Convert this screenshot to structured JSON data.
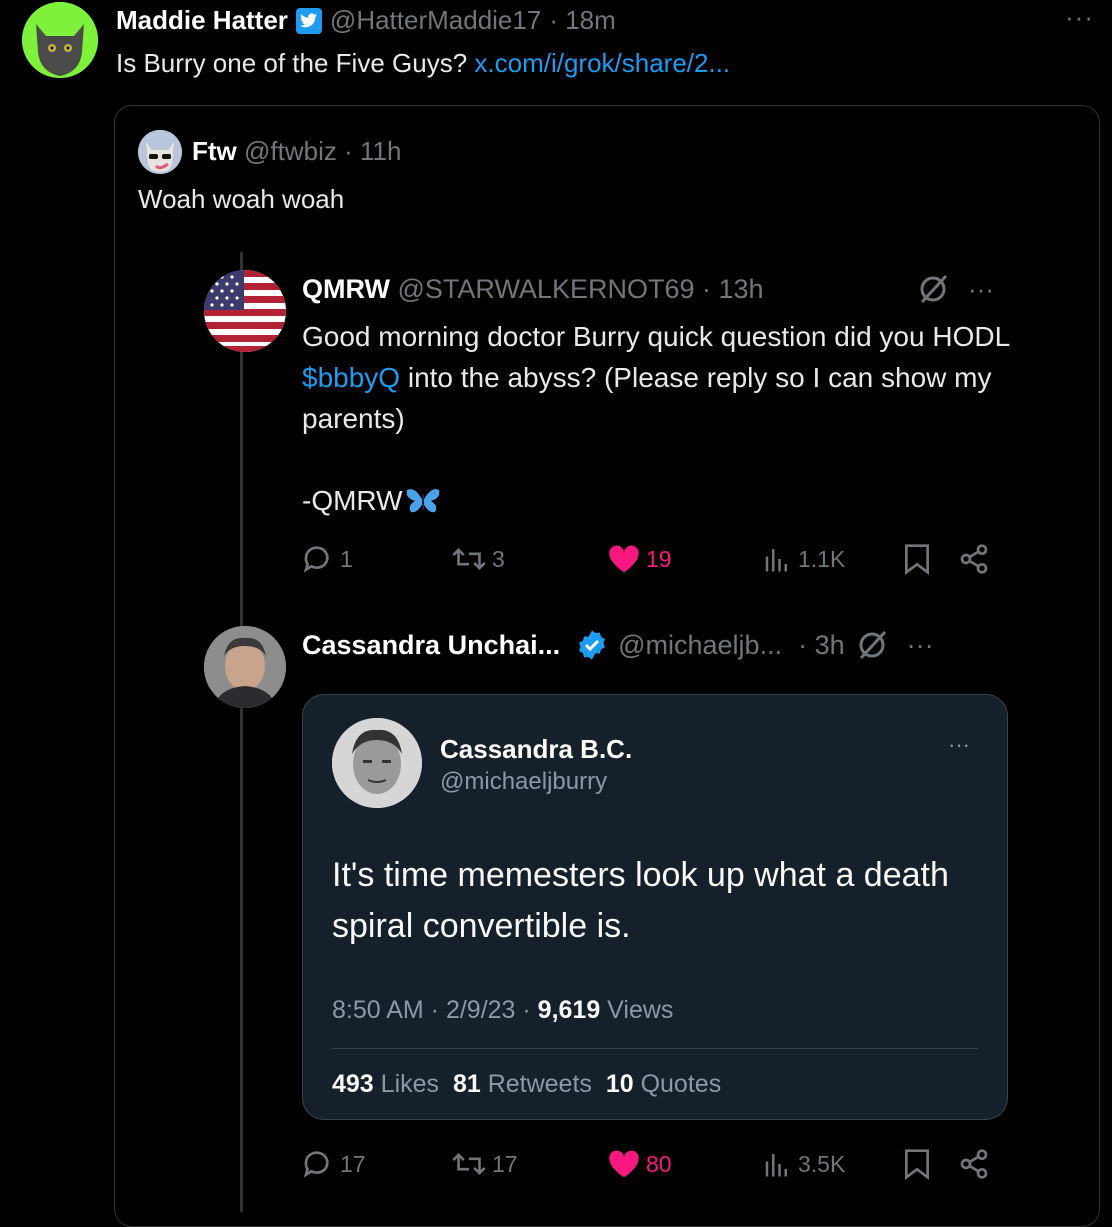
{
  "top_tweet": {
    "name": "Maddie Hatter",
    "handle": "@HatterMaddie17",
    "time": "· 18m",
    "more": "···",
    "text": "Is Burry one of the Five Guys?",
    "link": "x.com/i/grok/share/2..."
  },
  "quoted": {
    "name": "Ftw",
    "handle": "@ftwbiz",
    "time": "· 11h",
    "text": "Woah woah woah"
  },
  "qmrw_tweet": {
    "name": "QMRW",
    "handle": "@STARWALKERNOT69",
    "time": "· 13h",
    "text_before": "Good morning doctor Burry quick question did you HODL ",
    "cashtag": "$bbbyQ",
    "text_after": " into the abyss? (Please reply so I can show my parents)",
    "signature": "-QMRW",
    "more": "···",
    "actions": {
      "replies": "1",
      "retweets": "3",
      "likes": "19",
      "views": "1.1K"
    }
  },
  "cassandra_tweet": {
    "name": "Cassandra Unchai...",
    "handle": "@michaeljb...",
    "time": "· 3h",
    "more": "···",
    "actions": {
      "replies": "17",
      "retweets": "17",
      "likes": "80",
      "views": "3.5K"
    }
  },
  "inner_tweet": {
    "name": "Cassandra B.C.",
    "handle": "@michaeljburry",
    "more": "···",
    "text": "It's time memesters look up what a death spiral convertible is.",
    "time": "8:50 AM · 2/9/23 · ",
    "views_count": "9,619",
    "views_label": " Views",
    "likes_count": "493",
    "likes_label": " Likes",
    "retweets_count": "81",
    "retweets_label": " Retweets",
    "quotes_count": "10",
    "quotes_label": " Quotes"
  },
  "colors": {
    "link": "#1d9bf0",
    "like": "#f91880",
    "verified": "#1d9bf0",
    "inner_card_bg": "#15202b"
  }
}
